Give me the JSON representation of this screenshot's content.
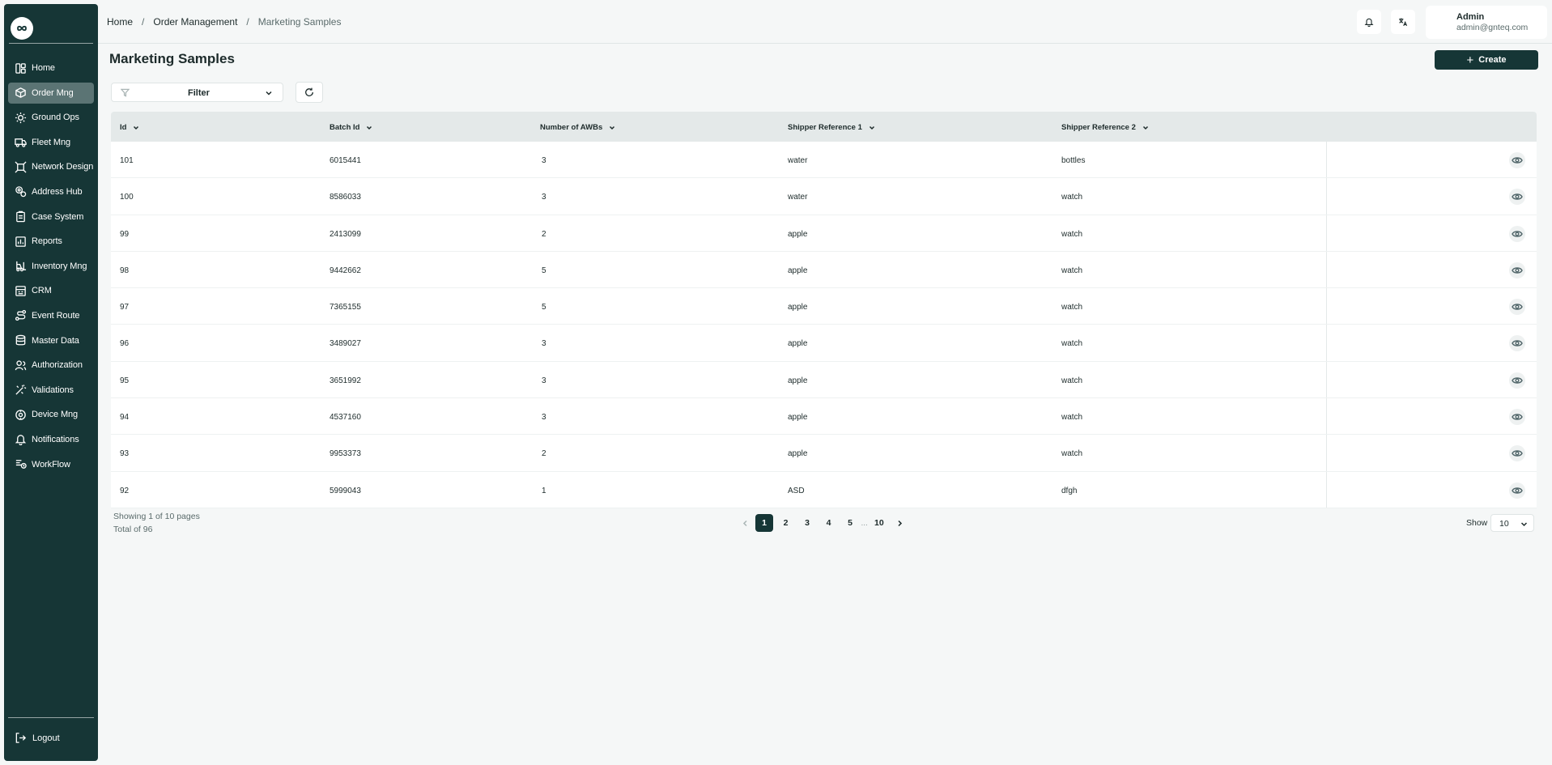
{
  "breadcrumb": {
    "home": "Home",
    "section": "Order Management",
    "current": "Marketing Samples"
  },
  "user": {
    "name": "Admin",
    "email": "admin@gnteq.com"
  },
  "sidebar": {
    "items": [
      {
        "label": "Home",
        "icon": "layout-icon"
      },
      {
        "label": "Order Mng",
        "icon": "box-icon"
      },
      {
        "label": "Ground Ops",
        "icon": "sun-icon"
      },
      {
        "label": "Fleet Mng",
        "icon": "truck-icon"
      },
      {
        "label": "Network Design",
        "icon": "network-icon"
      },
      {
        "label": "Address Hub",
        "icon": "pin-icon"
      },
      {
        "label": "Case System",
        "icon": "clipboard-icon"
      },
      {
        "label": "Reports",
        "icon": "chart-icon"
      },
      {
        "label": "Inventory Mng",
        "icon": "forklift-icon"
      },
      {
        "label": "CRM",
        "icon": "crm-icon"
      },
      {
        "label": "Event Route",
        "icon": "route-icon"
      },
      {
        "label": "Master Data",
        "icon": "database-icon"
      },
      {
        "label": "Authorization",
        "icon": "users-icon"
      },
      {
        "label": "Validations",
        "icon": "wand-icon"
      },
      {
        "label": "Device Mng",
        "icon": "device-icon"
      },
      {
        "label": "Notifications",
        "icon": "bell-icon"
      },
      {
        "label": "WorkFlow",
        "icon": "workflow-icon"
      }
    ],
    "active": "Order Mng",
    "logout": "Logout"
  },
  "page": {
    "title": "Marketing Samples",
    "create_label": "Create"
  },
  "filter": {
    "label": "Filter"
  },
  "table": {
    "columns": [
      "Id",
      "Batch Id",
      "Number of AWBs",
      "Shipper Reference 1",
      "Shipper Reference 2"
    ],
    "rows": [
      {
        "id": "101",
        "batch": "6015441",
        "awbs": "3",
        "ref1": "water",
        "ref2": "bottles"
      },
      {
        "id": "100",
        "batch": "8586033",
        "awbs": "3",
        "ref1": "water",
        "ref2": "watch"
      },
      {
        "id": "99",
        "batch": "2413099",
        "awbs": "2",
        "ref1": "apple",
        "ref2": "watch"
      },
      {
        "id": "98",
        "batch": "9442662",
        "awbs": "5",
        "ref1": "apple",
        "ref2": "watch"
      },
      {
        "id": "97",
        "batch": "7365155",
        "awbs": "5",
        "ref1": "apple",
        "ref2": "watch"
      },
      {
        "id": "96",
        "batch": "3489027",
        "awbs": "3",
        "ref1": "apple",
        "ref2": "watch"
      },
      {
        "id": "95",
        "batch": "3651992",
        "awbs": "3",
        "ref1": "apple",
        "ref2": "watch"
      },
      {
        "id": "94",
        "batch": "4537160",
        "awbs": "3",
        "ref1": "apple",
        "ref2": "watch"
      },
      {
        "id": "93",
        "batch": "9953373",
        "awbs": "2",
        "ref1": "apple",
        "ref2": "watch"
      },
      {
        "id": "92",
        "batch": "5999043",
        "awbs": "1",
        "ref1": "ASD",
        "ref2": "dfgh"
      }
    ]
  },
  "pagination": {
    "showing": "Showing 1 of 10 pages",
    "total": "Total of 96",
    "pages": [
      "1",
      "2",
      "3",
      "4",
      "5"
    ],
    "ellipsis": "...",
    "last": "10",
    "current": "1",
    "show_label": "Show",
    "page_size": "10"
  },
  "colors": {
    "sidebar": "#163636",
    "active_nav": "#5b7474",
    "primary": "#163636",
    "header_row": "#e4e9e9",
    "background": "#f5f7f7"
  }
}
